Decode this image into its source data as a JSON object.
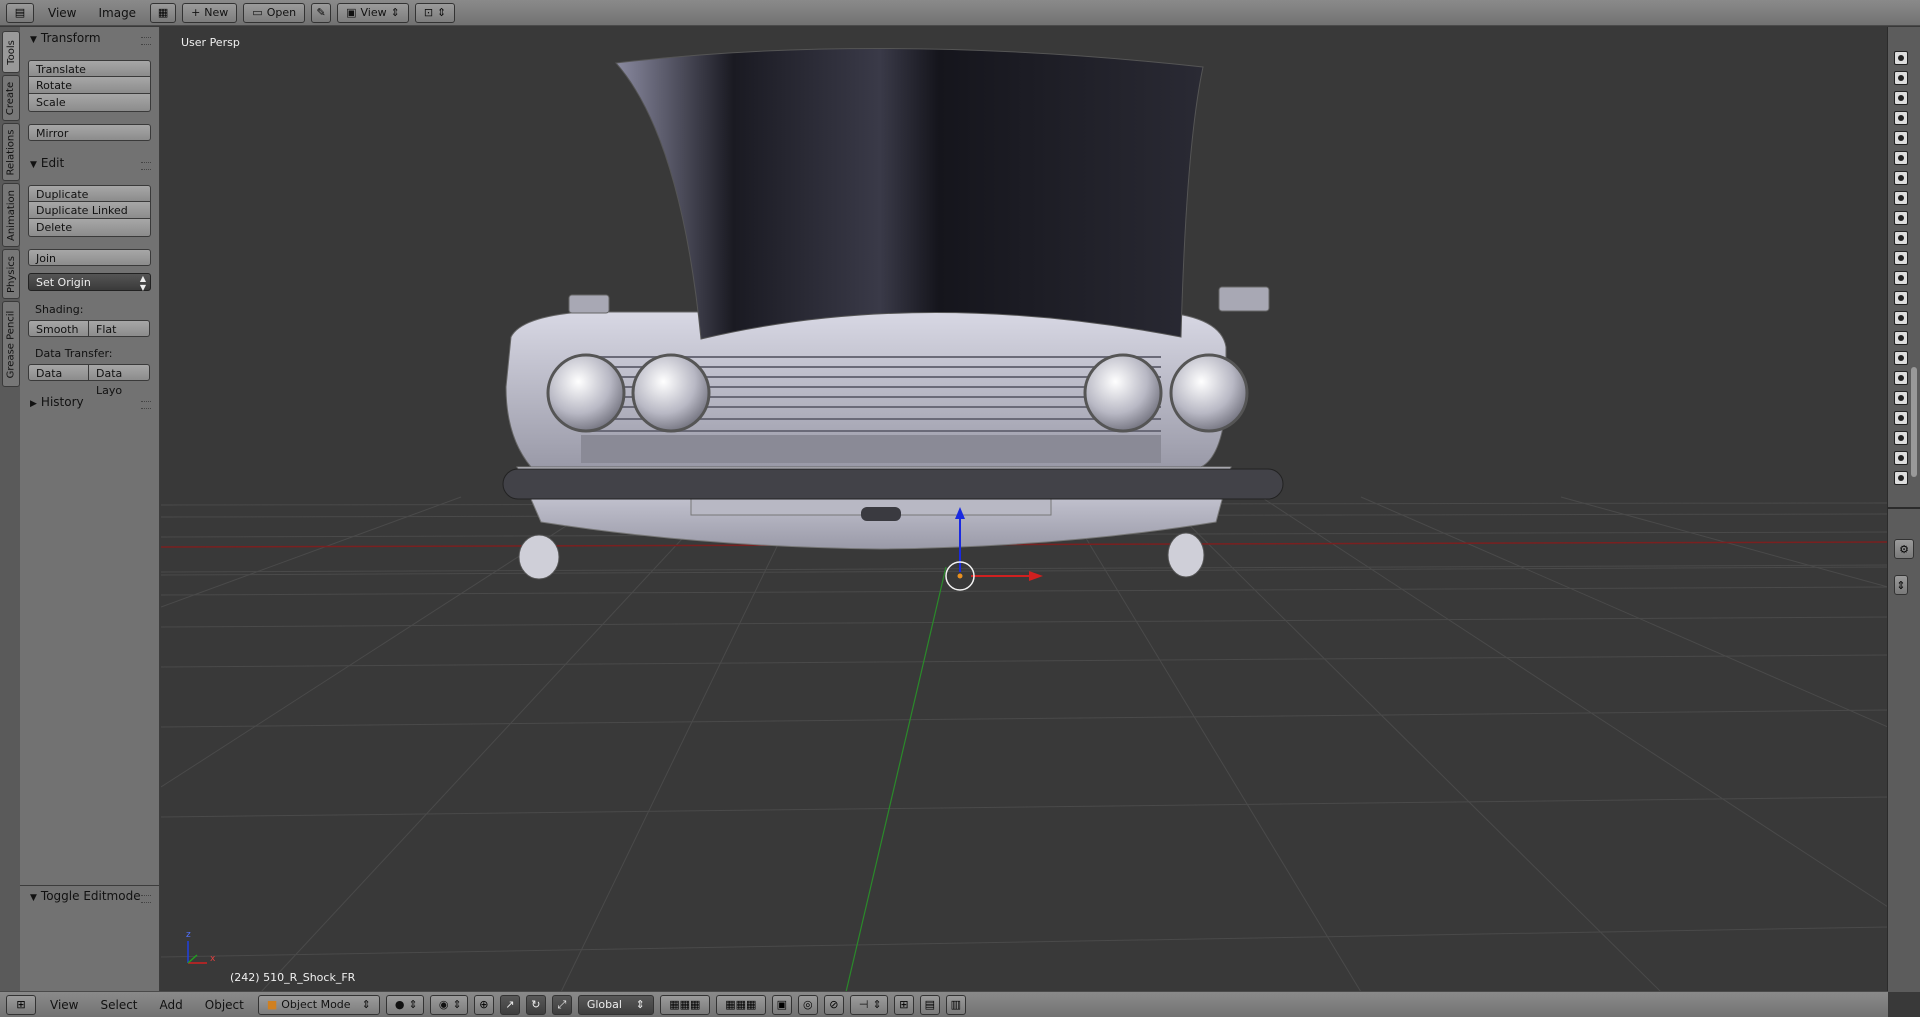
{
  "top_bar": {
    "menus": [
      "View",
      "Image"
    ],
    "new_label": "New",
    "open_label": "Open",
    "view_label": "View"
  },
  "tool_tabs": [
    "Tools",
    "Create",
    "Relations",
    "Animation",
    "Physics",
    "Grease Pencil"
  ],
  "tool_shelf": {
    "transform": {
      "title": "Transform",
      "buttons": [
        "Translate",
        "Rotate",
        "Scale",
        "Mirror"
      ]
    },
    "edit": {
      "title": "Edit",
      "buttons": [
        "Duplicate",
        "Duplicate Linked",
        "Delete",
        "Join"
      ],
      "set_origin": "Set Origin",
      "shading_label": "Shading:",
      "shading_buttons": [
        "Smooth",
        "Flat"
      ],
      "data_transfer_label": "Data Transfer:",
      "data_transfer_buttons": [
        "Data",
        "Data Layo"
      ]
    },
    "history": {
      "title": "History"
    },
    "operator": {
      "title": "Toggle Editmode"
    }
  },
  "viewport": {
    "view_name": "User Persp",
    "object_info": "(242) 510_R_Shock_FR",
    "axis_x": "x",
    "axis_z": "z"
  },
  "bottom_bar": {
    "menus": [
      "View",
      "Select",
      "Add",
      "Object"
    ],
    "mode": "Object Mode",
    "orientation": "Global"
  },
  "colors": {
    "viewport_bg": "#393939",
    "x_axis": "#c82828",
    "y_axis": "#2a8a2a",
    "z_gizmo": "#1a2ae0"
  }
}
